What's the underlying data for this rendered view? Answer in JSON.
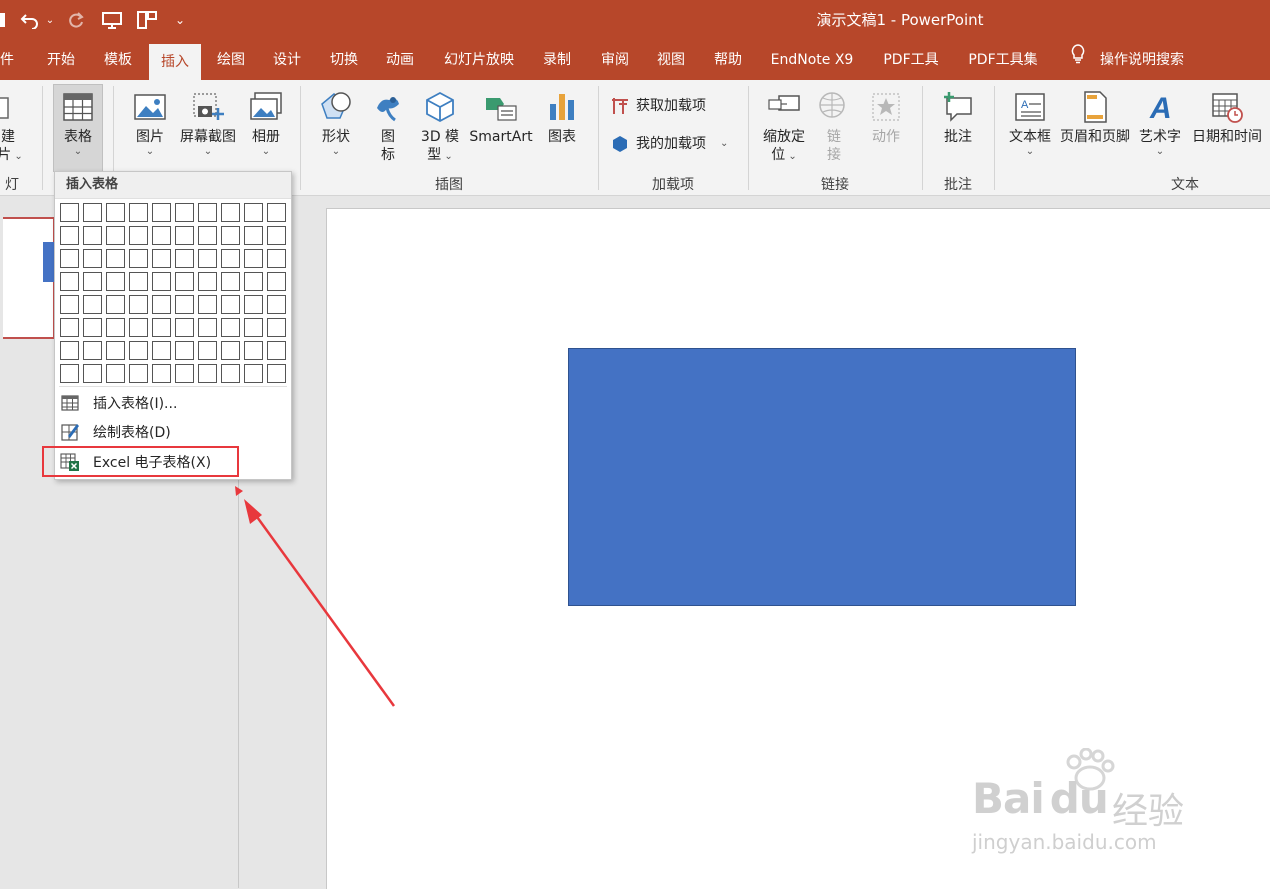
{
  "window": {
    "title": "演示文稿1  -  PowerPoint",
    "title_bar_color": "#b7472a"
  },
  "tabs": [
    {
      "label": "件"
    },
    {
      "label": "开始"
    },
    {
      "label": "模板"
    },
    {
      "label": "插入",
      "active": true
    },
    {
      "label": "绘图"
    },
    {
      "label": "设计"
    },
    {
      "label": "切换"
    },
    {
      "label": "动画"
    },
    {
      "label": "幻灯片放映"
    },
    {
      "label": "录制"
    },
    {
      "label": "审阅"
    },
    {
      "label": "视图"
    },
    {
      "label": "帮助"
    },
    {
      "label": "EndNote X9"
    },
    {
      "label": "PDF工具"
    },
    {
      "label": "PDF工具集"
    },
    {
      "label": "操作说明搜索",
      "icon": "lightbulb-icon"
    }
  ],
  "ribbon": {
    "new_slide_top": "建",
    "new_slide_bottom": "片",
    "table": "表格",
    "picture": "图片",
    "screenshot": "屏幕截图",
    "album": "相册",
    "shapes": "形状",
    "icons_top": "图",
    "icons_bottom": "标",
    "model3d_top": "3D 模",
    "model3d_bottom": "型",
    "smartart": "SmartArt",
    "chart": "图表",
    "get_addins": "获取加载项",
    "my_addins": "我的加载项",
    "zoom_top": "缩放定",
    "zoom_bottom": "位",
    "link_top": "链",
    "link_bottom": "接",
    "action": "动作",
    "comment": "批注",
    "textbox": "文本框",
    "header_footer": "页眉和页脚",
    "wordart": "艺术字",
    "datetime": "日期和时间",
    "groups": {
      "slides": "灯片",
      "illustrations": "插图",
      "addins": "加载项",
      "links": "链接",
      "comments": "批注",
      "text": "文本"
    }
  },
  "dropdown": {
    "header": "插入表格",
    "grid_cols": 10,
    "grid_rows": 8,
    "items": [
      {
        "label": "插入表格(I)...",
        "icon": "insert-table-icon"
      },
      {
        "label": "绘制表格(D)",
        "icon": "draw-table-icon"
      },
      {
        "label": "Excel 电子表格(X)",
        "icon": "excel-sheet-icon",
        "highlighted": true
      }
    ]
  },
  "watermark": {
    "brand": "Bai",
    "brand2": "du",
    "suffix": "经验",
    "url": "jingyan.baidu.com"
  },
  "colors": {
    "accent": "#b7472a",
    "shape_fill": "#4472c4",
    "highlight": "#e8383d"
  }
}
